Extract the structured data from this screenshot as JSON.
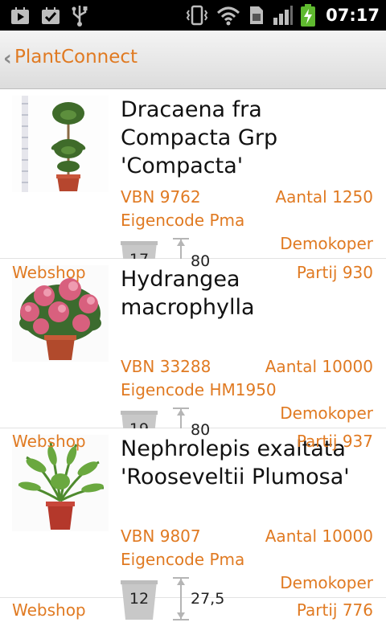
{
  "status": {
    "time": "07:17"
  },
  "appbar": {
    "title": "PlantConnect"
  },
  "items": [
    {
      "name": "Dracaena fra Compacta Grp 'Compacta'",
      "vbn": "VBN 9762",
      "aantal": "Aantal 1250",
      "eigencode": "Eigencode Pma",
      "koper": "Demokoper",
      "partij": "Partij 930",
      "webshop": "Webshop",
      "pot_size": "17",
      "height": "80"
    },
    {
      "name": "Hydrangea macrophylla",
      "vbn": "VBN 33288",
      "aantal": "Aantal 10000",
      "eigencode": "Eigencode HM1950",
      "koper": "Demokoper",
      "partij": "Partij 937",
      "webshop": "Webshop",
      "pot_size": "19",
      "height": "80"
    },
    {
      "name": "Nephrolepis exaltata 'Rooseveltii Plumosa'",
      "vbn": "VBN 9807",
      "aantal": "Aantal 10000",
      "eigencode": "Eigencode Pma",
      "koper": "Demokoper",
      "partij": "Partij 776",
      "webshop": "Webshop",
      "pot_size": "12",
      "height": "27,5"
    }
  ],
  "colors": {
    "accent": "#e07a22",
    "pot": "#c8c8c8"
  }
}
